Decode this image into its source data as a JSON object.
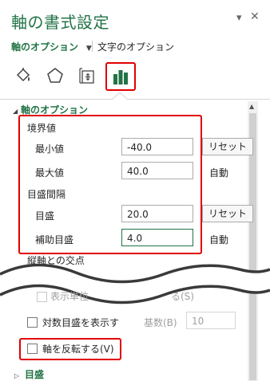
{
  "pane": {
    "title": "軸の書式設定",
    "pin_glyph": "▾",
    "close_glyph": "✕"
  },
  "tabs": {
    "axis_options": "軸のオプション",
    "dropdown_glyph": "▼",
    "text_options": "文字のオプション"
  },
  "icons": [
    "fill-line-icon",
    "effects-pentagon-icon",
    "size-properties-icon",
    "axis-options-bar-chart-icon"
  ],
  "sections": {
    "axis_options_title": "軸のオプション",
    "expand_glyph": "◢",
    "bounds": {
      "heading": "境界値",
      "min_label": "最小値",
      "min_value": "-40.0",
      "min_button": "リセット",
      "max_label": "最大値",
      "max_value": "40.0",
      "max_status": "自動"
    },
    "units": {
      "heading": "目盛間隔",
      "major_label": "目盛",
      "major_value": "20.0",
      "major_button": "リセット",
      "minor_label": "補助目盛",
      "minor_value": "4.0",
      "minor_status": "自動"
    },
    "cross_heading": "縦軸との交点",
    "display_units_label": "表示単位",
    "display_units_suffix": "る(S)",
    "log_scale_label": "対数目盛を表示す",
    "base_label": "基数(B)",
    "base_value": "10",
    "reverse_label": "軸を反転する(V)",
    "tick_marks_label": "目盛",
    "collapse_glyph": "▷"
  },
  "colors": {
    "accent": "#217346",
    "highlight": "#e00000"
  }
}
